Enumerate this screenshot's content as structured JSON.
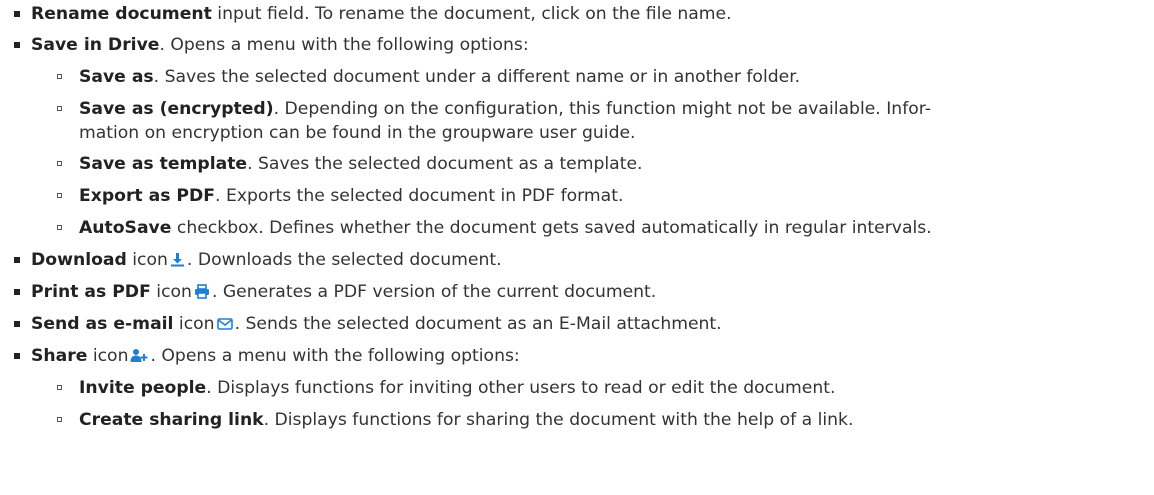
{
  "accent_color": "#1d7fd6",
  "items": [
    {
      "bold": "Rename document",
      "text": " input field. To rename the document, click on the file name."
    },
    {
      "bold": "Save in Drive",
      "text": ". Opens a menu with the following options:"
    },
    {
      "bold": "Save as",
      "text": ". Saves the selected document under a different name or in another folder."
    },
    {
      "bold": "Save as (encrypted)",
      "text": ". Depending on the configuration, this function might not be available. Infor-",
      "cont": "mation on encryption can be found in the groupware user guide."
    },
    {
      "bold": "Save as template",
      "text": ". Saves the selected document as a template."
    },
    {
      "bold": "Export as PDF",
      "text": ". Exports the selected document in PDF format."
    },
    {
      "bold": "AutoSave",
      "text": " checkbox. Defines whether the document gets saved automatically in regular intervals."
    },
    {
      "bold": "Download",
      "pre": " icon",
      "icon": "download-icon",
      "text": ". Downloads the selected document."
    },
    {
      "bold": "Print as PDF",
      "pre": " icon",
      "icon": "print-icon",
      "text": ". Generates a PDF version of the current document."
    },
    {
      "bold": "Send as e-mail",
      "pre": " icon",
      "icon": "mail-icon",
      "text": ". Sends the selected document as an E-Mail attachment."
    },
    {
      "bold": "Share",
      "pre": " icon",
      "icon": "share-icon",
      "text": ". Opens a menu with the following options:"
    },
    {
      "bold": "Invite people",
      "text": ". Displays functions for inviting other users to read or edit the document."
    },
    {
      "bold": "Create sharing link",
      "text": ". Displays functions for sharing the document with the help of a link."
    }
  ]
}
